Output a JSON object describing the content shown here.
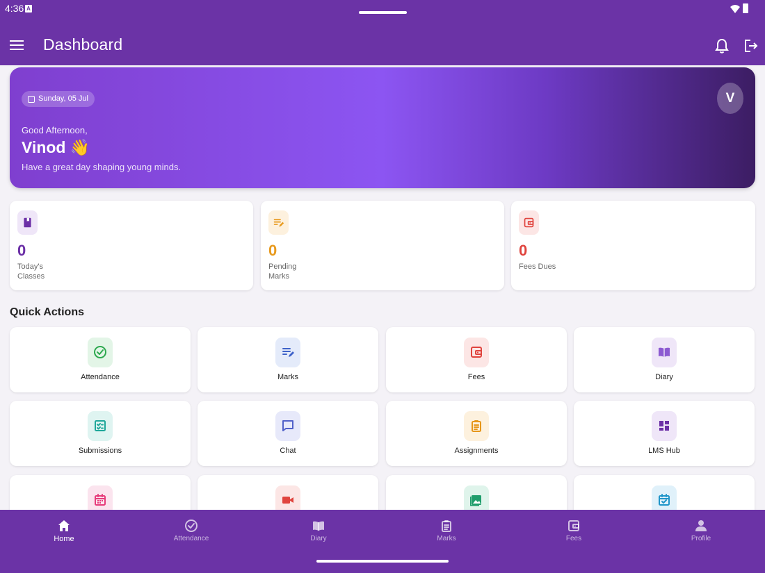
{
  "status_bar": {
    "time": "4:36"
  },
  "app_bar": {
    "title": "Dashboard"
  },
  "hero": {
    "date": "Sunday, 05 Jul",
    "greeting": "Good Afternoon,",
    "name": "Vinod 👋",
    "tagline": "Have a great day shaping young minds.",
    "avatar_initial": "V"
  },
  "stats": [
    {
      "value": "0",
      "label": "Today's Classes",
      "color": "#6b2fa6",
      "bg": "#efe6f8",
      "icon": "book-icon"
    },
    {
      "value": "0",
      "label": "Pending Marks",
      "color": "#e89a1e",
      "bg": "#fdf1de",
      "icon": "edit-list-icon"
    },
    {
      "value": "0",
      "label": "Fees Dues",
      "color": "#e0443e",
      "bg": "#fce6e5",
      "icon": "wallet-icon"
    }
  ],
  "quick_actions_title": "Quick Actions",
  "quick_actions": [
    {
      "label": "Attendance",
      "icon": "check-circle-icon",
      "color": "#2ea94f",
      "bg": "#e3f5e7"
    },
    {
      "label": "Marks",
      "icon": "edit-list-icon",
      "color": "#3f63c9",
      "bg": "#e4ebfa"
    },
    {
      "label": "Fees",
      "icon": "wallet-icon",
      "color": "#e0443e",
      "bg": "#fce6e5"
    },
    {
      "label": "Diary",
      "icon": "open-book-icon",
      "color": "#8c5ad1",
      "bg": "#efe6f8"
    },
    {
      "label": "Submissions",
      "icon": "checklist-icon",
      "color": "#1ea79a",
      "bg": "#dff4f1"
    },
    {
      "label": "Chat",
      "icon": "chat-icon",
      "color": "#5161c9",
      "bg": "#e7e9fa"
    },
    {
      "label": "Assignments",
      "icon": "clipboard-icon",
      "color": "#e6961a",
      "bg": "#fdf1de"
    },
    {
      "label": "LMS Hub",
      "icon": "dashboard-icon",
      "color": "#6b2fa6",
      "bg": "#efe6f8"
    },
    {
      "label": "",
      "icon": "calendar-icon",
      "color": "#e63b7a",
      "bg": "#fbe4ee"
    },
    {
      "label": "",
      "icon": "video-icon",
      "color": "#e0443e",
      "bg": "#fce6e5"
    },
    {
      "label": "",
      "icon": "image-icon",
      "color": "#1f9d6b",
      "bg": "#dff4eb"
    },
    {
      "label": "",
      "icon": "calendar-check-icon",
      "color": "#1f95c9",
      "bg": "#e0f1fa"
    }
  ],
  "bottom_nav": [
    {
      "label": "Home",
      "icon": "home-icon",
      "active": true
    },
    {
      "label": "Attendance",
      "icon": "check-circle-icon",
      "active": false
    },
    {
      "label": "Diary",
      "icon": "open-book-icon",
      "active": false
    },
    {
      "label": "Marks",
      "icon": "clipboard-icon",
      "active": false
    },
    {
      "label": "Fees",
      "icon": "wallet-icon",
      "active": false
    },
    {
      "label": "Profile",
      "icon": "person-icon",
      "active": false
    }
  ],
  "colors": {
    "primary": "#6b33a6",
    "background": "#f4f2f7"
  }
}
